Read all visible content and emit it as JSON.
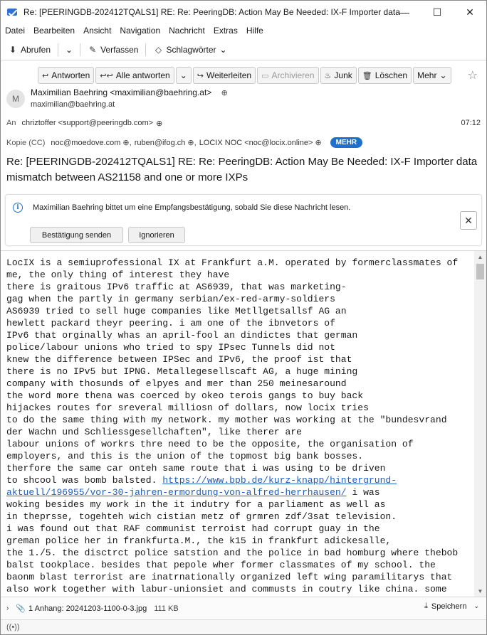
{
  "window": {
    "title": "Re: [PEERINGDB-202412TQALS1] RE: Re: PeeringDB: Action May Be Needed: IX-F Importer data ...",
    "minimize_glyph": "—",
    "maximize_glyph": "☐",
    "close_glyph": "✕"
  },
  "menu": {
    "items": [
      "Datei",
      "Bearbeiten",
      "Ansicht",
      "Navigation",
      "Nachricht",
      "Extras",
      "Hilfe"
    ]
  },
  "toolbar": {
    "fetch_label": "Abrufen",
    "compose_label": "Verfassen",
    "tags_label": "Schlagwörter"
  },
  "actions": {
    "reply": "Antworten",
    "reply_all": "Alle antworten",
    "forward": "Weiterleiten",
    "archive": "Archivieren",
    "junk": "Junk",
    "delete": "Löschen",
    "more": "Mehr"
  },
  "message": {
    "avatar_initial": "M",
    "from_display": "Maximilian Baehring <maximilian@baehring.at>",
    "from_address": "maximilian@baehring.at",
    "to_label": "An",
    "to_value": "chriztoffer <support@peeringdb.com>",
    "time": "07:12",
    "cc_label": "Kopie (CC)",
    "cc": [
      "noc@moedove.com",
      "ruben@ifog.ch",
      "LOCIX NOC <noc@locix.online>"
    ],
    "more_badge": "MEHR",
    "subject": "Re: [PEERINGDB-202412TQALS1] RE: Re: PeeringDB: Action May Be Needed: IX-F Importer data mismatch between AS21158 and one or more IXPs"
  },
  "notification": {
    "text": "Maximilian Baehring bittet um eine Empfangsbestätigung, sobald Sie diese Nachricht lesen.",
    "send_button": "Bestätigung senden",
    "ignore_button": "Ignorieren",
    "close_glyph": "✕"
  },
  "body": {
    "text_before_link": "LocIX is a semiuprofessional IX at Frankfurt a.M. operated by formerclassmates of\nme, the only thing of interest they have\nthere is graitous IPv6 traffic at AS6939, that was marketing-\ngag when the partly in germany serbian/ex-red-army-soldiers\nAS6939 tried to sell huge companies like Metllgetsallsf AG an\nhewlett packard theyr peering. i am one of the ibnvetors of\nIPv6 that orginally whas an april-fool an dindictes that german\npolice/labour unions who tried to spy IPsec Tunnels did not\nknew the difference between IPSec and IPv6, the proof ist that\nthere is no IPv5 but IPNG. Metallegesellscaft AG, a huge mining\ncompany with thosunds of elpyes and mer than 250 meinesaround\nthe word more thena was coerced by okeo terois gangs to buy back\nhijackes routes for sreveral milliosn of dollars, now locix tries\nto do the same thing with my network. my mother was working at the \"bundesvrand\nder Wachn und Schliessgesellchaften\", like therer are\nlabour unions of workrs thre need to be the opposite, the organisation of\nemployers, and this is the union of the topmost big bank bosses.\ntherfore the same car onteh same route that i was using to be driven\nto shcool was bomb balsted. ",
    "link": "https://www.bpb.de/kurz-knapp/hintergrund-aktuell/196955/vor-30-jahren-ermordung-von-alfred-herrhausen/",
    "text_after_link": " i was\nwoking besides my work in the it indutry for a parliament as well as\nin theprsse, togehteh wich cistian metz of grmren zdf/3sat television.\ni was found out that RAF communist terroist had corrupt guay in the\ngreman police her in frankfurta.M., the k15 in frankfurt adickesalle,\nthe 1./5. the disctrct police satstion and the police in bad homburg where thebob\nbalst tookplace. besides that pepole wher former classmates of my school. the\nbaonm blast terrorist are inatrnationally organized left wing paramilitarys that\nalso work together with labur-unionsiet and commusts in coutry like china. some"
  },
  "attachment": {
    "summary": "1 Anhang: 20241203-1100-0-3.jpg",
    "size": "111 KB",
    "save_label": "Speichern"
  },
  "colors": {
    "accent": "#1f6fd1",
    "link": "#1f5fc0"
  }
}
